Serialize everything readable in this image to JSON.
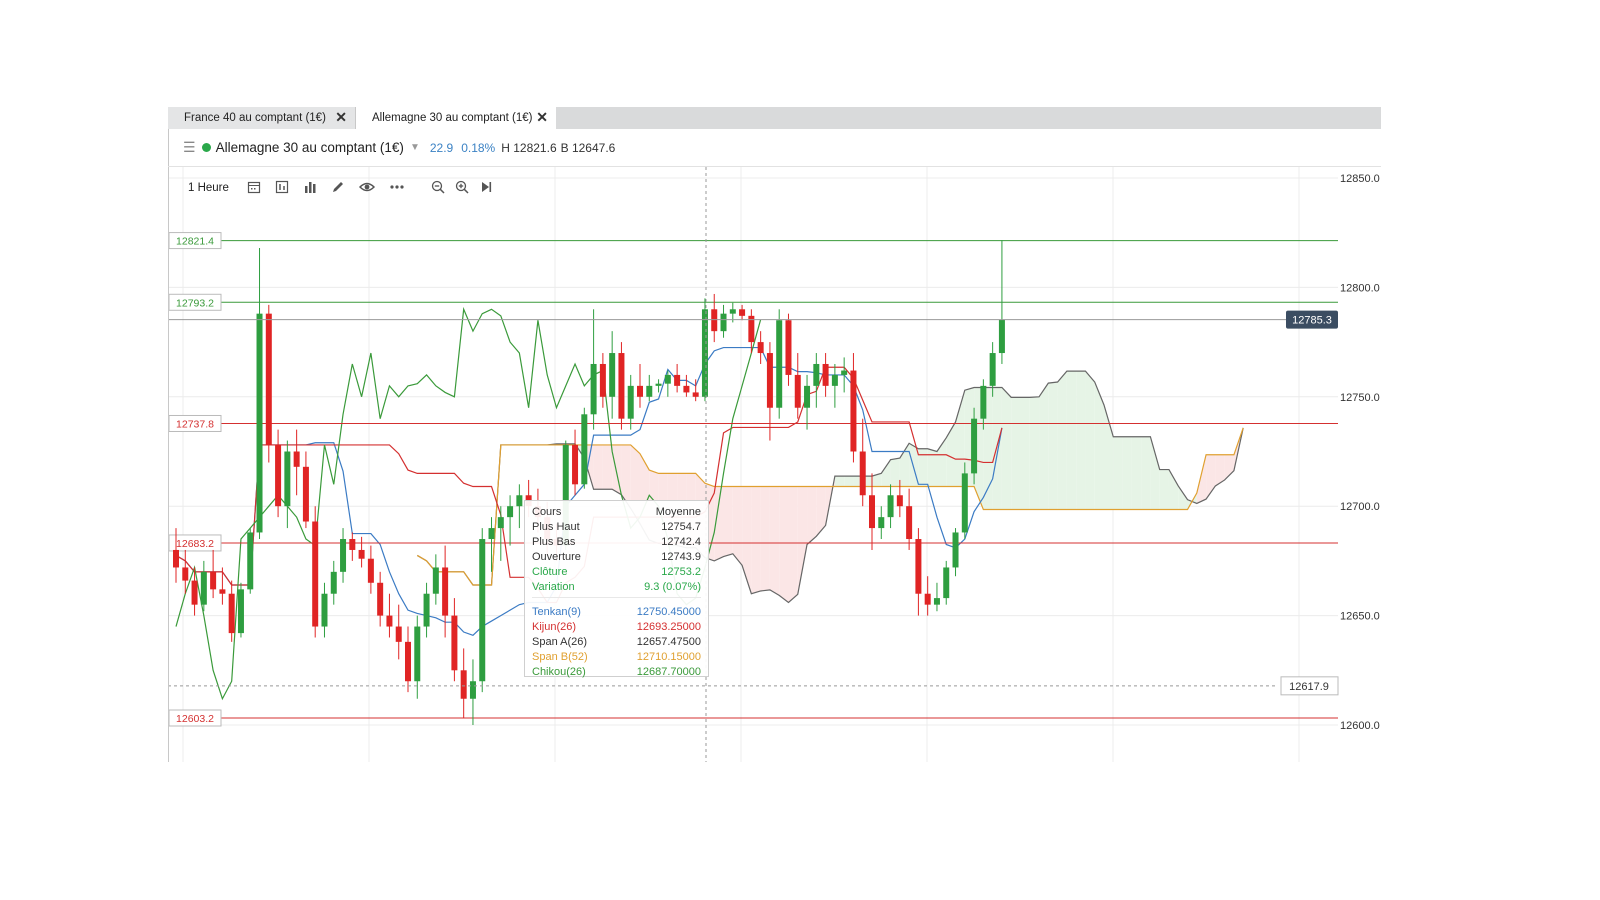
{
  "tabs": [
    {
      "label": "France 40 au comptant (1€)",
      "close": "✕",
      "active": false
    },
    {
      "label": "Allemagne 30 au comptant (1€)",
      "close": "✕",
      "active": true
    }
  ],
  "header": {
    "menu_icon": "hamburger-icon",
    "status_color": "#2aa84a",
    "instrument": "Allemagne 30 au comptant (1€)",
    "change": "22.9",
    "change_pct": "0.18%",
    "high": "H 12821.6",
    "low": "B 12647.6"
  },
  "toolbar": {
    "timeframe": "1 Heure",
    "icons": [
      "calendar-icon",
      "chart-type-icon",
      "bar-chart-icon",
      "pencil-icon",
      "eye-icon",
      "more-icon",
      "zoom-out-icon",
      "zoom-in-icon",
      "skip-end-icon"
    ]
  },
  "tooltip": {
    "headers": [
      "Cours",
      "Moyenne"
    ],
    "rows": [
      {
        "label": "Plus Haut",
        "value": "12754.7",
        "color": "#333333"
      },
      {
        "label": "Plus Bas",
        "value": "12742.4",
        "color": "#333333"
      },
      {
        "label": "Ouverture",
        "value": "12743.9",
        "color": "#333333"
      },
      {
        "label": "Clôture",
        "value": "12753.2",
        "color": "#2aa84a"
      },
      {
        "label": "Variation",
        "value": "9.3 (0.07%)",
        "color": "#2aa84a"
      }
    ],
    "indicators": [
      {
        "label": "Tenkan(9)",
        "value": "12750.45000",
        "color": "#3b7bc4"
      },
      {
        "label": "Kijun(26)",
        "value": "12693.25000",
        "color": "#d43030"
      },
      {
        "label": "Span A(26)",
        "value": "12657.47500",
        "color": "#333333"
      },
      {
        "label": "Span B(52)",
        "value": "12710.15000",
        "color": "#e0a030"
      },
      {
        "label": "Chikou(26)",
        "value": "12687.70000",
        "color": "#3a9a3a"
      }
    ]
  },
  "chart_data": {
    "type": "candlestick",
    "ylim": [
      12585,
      12864
    ],
    "y_ticks": [
      "12850.0",
      "12800.0",
      "12750.0",
      "12700.0",
      "12650.0",
      "12600.0"
    ],
    "current_price": "12785.3",
    "crosshair_price": "12617.9",
    "hlines": [
      {
        "label": "12821.4",
        "value": 12821.4,
        "color": "#3a9a3a"
      },
      {
        "label": "12793.2",
        "value": 12793.2,
        "color": "#3a9a3a"
      },
      {
        "label": "12737.8",
        "value": 12737.8,
        "color": "#d43030"
      },
      {
        "label": "12683.2",
        "value": 12683.2,
        "color": "#d43030"
      },
      {
        "label": "12603.2",
        "value": 12603.2,
        "color": "#d43030"
      }
    ],
    "colors": {
      "up": "#2e9e40",
      "down": "#e02424",
      "tenkan": "#3b7bc4",
      "kijun": "#d43030",
      "spanA": "#666666",
      "spanB": "#e0a030",
      "chikou": "#3a9a3a",
      "cloud_bull": "#e6f4e6",
      "cloud_bear": "#fbe6e6",
      "grid": "#ececec"
    },
    "candles": [
      {
        "o": 12680,
        "h": 12690,
        "l": 12665,
        "c": 12672
      },
      {
        "o": 12672,
        "h": 12680,
        "l": 12660,
        "c": 12666
      },
      {
        "o": 12666,
        "h": 12672,
        "l": 12650,
        "c": 12655
      },
      {
        "o": 12655,
        "h": 12675,
        "l": 12652,
        "c": 12670
      },
      {
        "o": 12670,
        "h": 12680,
        "l": 12658,
        "c": 12662
      },
      {
        "o": 12662,
        "h": 12672,
        "l": 12655,
        "c": 12660
      },
      {
        "o": 12660,
        "h": 12666,
        "l": 12638,
        "c": 12642
      },
      {
        "o": 12642,
        "h": 12665,
        "l": 12640,
        "c": 12662
      },
      {
        "o": 12662,
        "h": 12690,
        "l": 12660,
        "c": 12688
      },
      {
        "o": 12688,
        "h": 12818,
        "l": 12685,
        "c": 12788
      },
      {
        "o": 12788,
        "h": 12792,
        "l": 12720,
        "c": 12728
      },
      {
        "o": 12728,
        "h": 12735,
        "l": 12695,
        "c": 12700
      },
      {
        "o": 12700,
        "h": 12730,
        "l": 12690,
        "c": 12725
      },
      {
        "o": 12725,
        "h": 12735,
        "l": 12705,
        "c": 12718
      },
      {
        "o": 12718,
        "h": 12725,
        "l": 12690,
        "c": 12693
      },
      {
        "o": 12693,
        "h": 12700,
        "l": 12640,
        "c": 12645
      },
      {
        "o": 12645,
        "h": 12665,
        "l": 12640,
        "c": 12660
      },
      {
        "o": 12660,
        "h": 12675,
        "l": 12655,
        "c": 12670
      },
      {
        "o": 12670,
        "h": 12690,
        "l": 12665,
        "c": 12685
      },
      {
        "o": 12685,
        "h": 12688,
        "l": 12675,
        "c": 12680
      },
      {
        "o": 12680,
        "h": 12686,
        "l": 12672,
        "c": 12676
      },
      {
        "o": 12676,
        "h": 12682,
        "l": 12660,
        "c": 12665
      },
      {
        "o": 12665,
        "h": 12670,
        "l": 12645,
        "c": 12650
      },
      {
        "o": 12650,
        "h": 12660,
        "l": 12640,
        "c": 12645
      },
      {
        "o": 12645,
        "h": 12655,
        "l": 12630,
        "c": 12638
      },
      {
        "o": 12638,
        "h": 12645,
        "l": 12615,
        "c": 12620
      },
      {
        "o": 12620,
        "h": 12650,
        "l": 12612,
        "c": 12645
      },
      {
        "o": 12645,
        "h": 12665,
        "l": 12640,
        "c": 12660
      },
      {
        "o": 12660,
        "h": 12678,
        "l": 12655,
        "c": 12672
      },
      {
        "o": 12672,
        "h": 12682,
        "l": 12640,
        "c": 12650
      },
      {
        "o": 12650,
        "h": 12658,
        "l": 12620,
        "c": 12625
      },
      {
        "o": 12625,
        "h": 12635,
        "l": 12603,
        "c": 12612
      },
      {
        "o": 12612,
        "h": 12630,
        "l": 12600,
        "c": 12620
      },
      {
        "o": 12620,
        "h": 12690,
        "l": 12615,
        "c": 12685
      },
      {
        "o": 12685,
        "h": 12695,
        "l": 12670,
        "c": 12690
      },
      {
        "o": 12690,
        "h": 12700,
        "l": 12675,
        "c": 12695
      },
      {
        "o": 12695,
        "h": 12705,
        "l": 12682,
        "c": 12700
      },
      {
        "o": 12700,
        "h": 12710,
        "l": 12690,
        "c": 12705
      },
      {
        "o": 12705,
        "h": 12712,
        "l": 12695,
        "c": 12700
      },
      {
        "o": 12700,
        "h": 12708,
        "l": 12688,
        "c": 12695
      },
      {
        "o": 12695,
        "h": 12702,
        "l": 12678,
        "c": 12685
      },
      {
        "o": 12685,
        "h": 12692,
        "l": 12675,
        "c": 12682
      },
      {
        "o": 12682,
        "h": 12730,
        "l": 12680,
        "c": 12728
      },
      {
        "o": 12728,
        "h": 12735,
        "l": 12705,
        "c": 12710
      },
      {
        "o": 12710,
        "h": 12745,
        "l": 12708,
        "c": 12742
      },
      {
        "o": 12742,
        "h": 12790,
        "l": 12735,
        "c": 12765
      },
      {
        "o": 12765,
        "h": 12770,
        "l": 12745,
        "c": 12750
      },
      {
        "o": 12750,
        "h": 12780,
        "l": 12740,
        "c": 12770
      },
      {
        "o": 12770,
        "h": 12775,
        "l": 12735,
        "c": 12740
      },
      {
        "o": 12740,
        "h": 12760,
        "l": 12735,
        "c": 12755
      },
      {
        "o": 12755,
        "h": 12765,
        "l": 12745,
        "c": 12750
      },
      {
        "o": 12750,
        "h": 12760,
        "l": 12748,
        "c": 12755
      },
      {
        "o": 12755,
        "h": 12758,
        "l": 12752,
        "c": 12756
      },
      {
        "o": 12756,
        "h": 12762,
        "l": 12750,
        "c": 12760
      },
      {
        "o": 12760,
        "h": 12765,
        "l": 12752,
        "c": 12755
      },
      {
        "o": 12755,
        "h": 12760,
        "l": 12750,
        "c": 12752
      },
      {
        "o": 12752,
        "h": 12758,
        "l": 12748,
        "c": 12750
      },
      {
        "o": 12750,
        "h": 12795,
        "l": 12748,
        "c": 12790
      },
      {
        "o": 12790,
        "h": 12797,
        "l": 12775,
        "c": 12780
      },
      {
        "o": 12780,
        "h": 12792,
        "l": 12777,
        "c": 12788
      },
      {
        "o": 12788,
        "h": 12793,
        "l": 12784,
        "c": 12790
      },
      {
        "o": 12790,
        "h": 12792,
        "l": 12785,
        "c": 12787
      },
      {
        "o": 12787,
        "h": 12790,
        "l": 12770,
        "c": 12775
      },
      {
        "o": 12775,
        "h": 12780,
        "l": 12765,
        "c": 12770
      },
      {
        "o": 12770,
        "h": 12775,
        "l": 12730,
        "c": 12745
      },
      {
        "o": 12745,
        "h": 12790,
        "l": 12740,
        "c": 12785
      },
      {
        "o": 12785,
        "h": 12788,
        "l": 12755,
        "c": 12760
      },
      {
        "o": 12760,
        "h": 12770,
        "l": 12740,
        "c": 12745
      },
      {
        "o": 12745,
        "h": 12760,
        "l": 12735,
        "c": 12755
      },
      {
        "o": 12755,
        "h": 12770,
        "l": 12745,
        "c": 12765
      },
      {
        "o": 12765,
        "h": 12770,
        "l": 12750,
        "c": 12755
      },
      {
        "o": 12755,
        "h": 12765,
        "l": 12745,
        "c": 12760
      },
      {
        "o": 12760,
        "h": 12768,
        "l": 12752,
        "c": 12762
      },
      {
        "o": 12762,
        "h": 12770,
        "l": 12720,
        "c": 12725
      },
      {
        "o": 12725,
        "h": 12740,
        "l": 12700,
        "c": 12705
      },
      {
        "o": 12705,
        "h": 12715,
        "l": 12680,
        "c": 12690
      },
      {
        "o": 12690,
        "h": 12700,
        "l": 12685,
        "c": 12695
      },
      {
        "o": 12695,
        "h": 12710,
        "l": 12690,
        "c": 12705
      },
      {
        "o": 12705,
        "h": 12712,
        "l": 12695,
        "c": 12700
      },
      {
        "o": 12700,
        "h": 12708,
        "l": 12680,
        "c": 12685
      },
      {
        "o": 12685,
        "h": 12690,
        "l": 12650,
        "c": 12660
      },
      {
        "o": 12660,
        "h": 12668,
        "l": 12650,
        "c": 12655
      },
      {
        "o": 12655,
        "h": 12665,
        "l": 12652,
        "c": 12658
      },
      {
        "o": 12658,
        "h": 12675,
        "l": 12655,
        "c": 12672
      },
      {
        "o": 12672,
        "h": 12690,
        "l": 12668,
        "c": 12688
      },
      {
        "o": 12688,
        "h": 12720,
        "l": 12685,
        "c": 12715
      },
      {
        "o": 12715,
        "h": 12745,
        "l": 12710,
        "c": 12740
      },
      {
        "o": 12740,
        "h": 12758,
        "l": 12735,
        "c": 12755
      },
      {
        "o": 12755,
        "h": 12775,
        "l": 12750,
        "c": 12770
      },
      {
        "o": 12770,
        "h": 12821.6,
        "l": 12765,
        "c": 12785.3
      }
    ]
  }
}
